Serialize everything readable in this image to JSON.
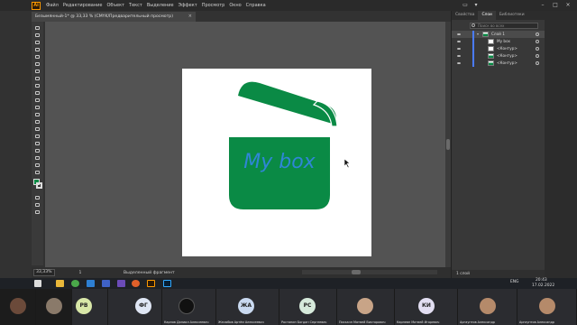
{
  "app": {
    "logo_text": "Ai",
    "menu": [
      "Файл",
      "Редактирование",
      "Объект",
      "Текст",
      "Выделение",
      "Эффект",
      "Просмотр",
      "Окно",
      "Справка"
    ],
    "doc_tab_title": "Безымянный-1* @ 33,33 % (CMYK/Предварительный просмотр)",
    "doc_tab_close": "×"
  },
  "artwork": {
    "text": "My box",
    "fill_color": "#0a8a45",
    "text_color": "#2f86d6"
  },
  "status_bar": {
    "zoom": "33,33%",
    "artboard_number": "1",
    "status_text": "Выделенный фрагмент"
  },
  "layers_panel": {
    "tabs": [
      "Свойства",
      "Слои",
      "Библиотеки"
    ],
    "active_tab": "Слои",
    "search_placeholder": "Поиск во всех",
    "layers": [
      {
        "name": "Слой 1",
        "level": 0
      },
      {
        "name": "My box",
        "level": 1
      },
      {
        "name": "<Контур>",
        "level": 1
      },
      {
        "name": "<Контур>",
        "level": 1
      },
      {
        "name": "<Контур>",
        "level": 1
      }
    ],
    "footer": "1 слой"
  },
  "taskbar": {
    "language": "ENG",
    "time": "20:43",
    "date": "17.02.2022"
  },
  "call": {
    "participants": [
      {
        "initials": "",
        "name": "",
        "color": "#6b4a3a"
      },
      {
        "initials": "",
        "name": "",
        "color": "#8a7a6a"
      },
      {
        "initials": "РВ",
        "name": "",
        "color": "#d8e7a8"
      },
      {
        "initials": "ФГ",
        "name": "",
        "color": "#dfe6f4"
      },
      {
        "initials": "",
        "name": "Карпов Даниил Алексеевич",
        "color": "#111111"
      },
      {
        "initials": "ЖА",
        "name": "Жесюбов Артём Алексеевич",
        "color": "#c9d9f0"
      },
      {
        "initials": "РС",
        "name": "Ростанин Богдан Сергеевич",
        "color": "#d6eadb"
      },
      {
        "initials": "",
        "name": "Пискачн Матвей Викторович",
        "color": "#c8a487"
      },
      {
        "initials": "КИ",
        "name": "Карпевн Матвей Игоревич",
        "color": "#e2def2"
      },
      {
        "initials": "",
        "name": "Аргаунтов Александр",
        "color": "#b58a6a"
      },
      {
        "initials": "",
        "name": "Аргаунтов Александр",
        "color": "#b58a6a"
      }
    ]
  }
}
